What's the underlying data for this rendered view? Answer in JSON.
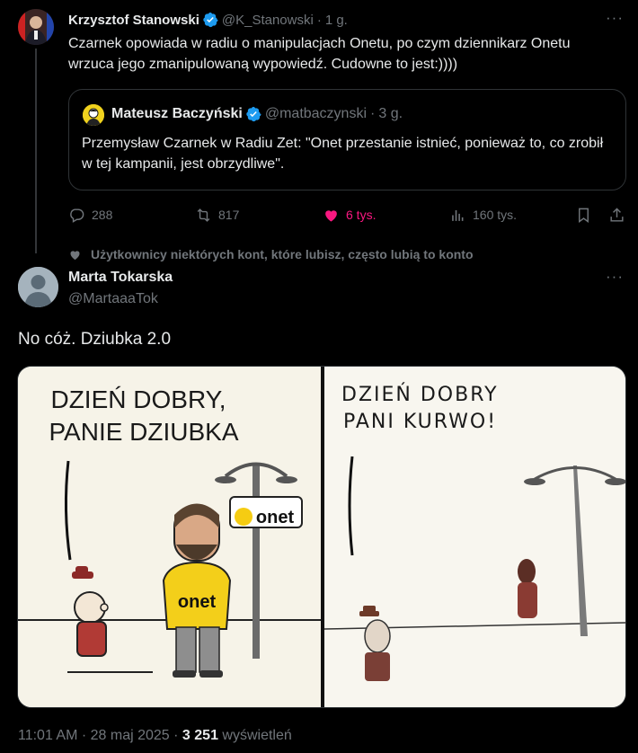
{
  "parent_tweet": {
    "author_name": "Krzysztof Stanowski",
    "author_handle": "@K_Stanowski",
    "separator": "·",
    "time_ago": "1 g.",
    "text": "Czarnek opowiada w radiu o manipulacjach Onetu, po czym dziennikarz Onetu wrzuca jego zmanipulowaną wypowiedź. Cudowne to jest:))))",
    "more_label": "···",
    "quote": {
      "author_name": "Mateusz Baczyński",
      "author_handle": "@matbaczynski",
      "separator": "·",
      "time_ago": "3 g.",
      "text": "Przemysław Czarnek w Radiu Zet: \"Onet przestanie istnieć, ponieważ to, co zrobił w tej kampanii, jest obrzydliwe\"."
    },
    "actions": {
      "replies": "288",
      "reposts": "817",
      "likes": "6 tys.",
      "views": "160 tys."
    },
    "colors": {
      "liked": "#f91880",
      "verified": "#1d9bf0"
    }
  },
  "social_context": "Użytkownicy niektórych kont, które lubisz, często lubią to konto",
  "main_tweet": {
    "author_name": "Marta Tokarska",
    "author_handle": "@MartaaaTok",
    "more_label": "···",
    "text": "No cóż. Dziubka 2.0",
    "image": {
      "left_panel": {
        "caption_line1": "DZIEŃ DOBRY,",
        "caption_line2": "PANIE DZIUBKA",
        "sign_text": "onet",
        "shirt_text": "onet"
      },
      "right_panel": {
        "caption_line1": "DZIEŃ DOBRY",
        "caption_line2": "PANI KURWO!"
      }
    },
    "footer": {
      "time": "11:01 AM",
      "sep1": " · ",
      "date": "28 maj 2025",
      "sep2": " · ",
      "views_count": "3 251",
      "views_label": " wyświetleń"
    }
  }
}
